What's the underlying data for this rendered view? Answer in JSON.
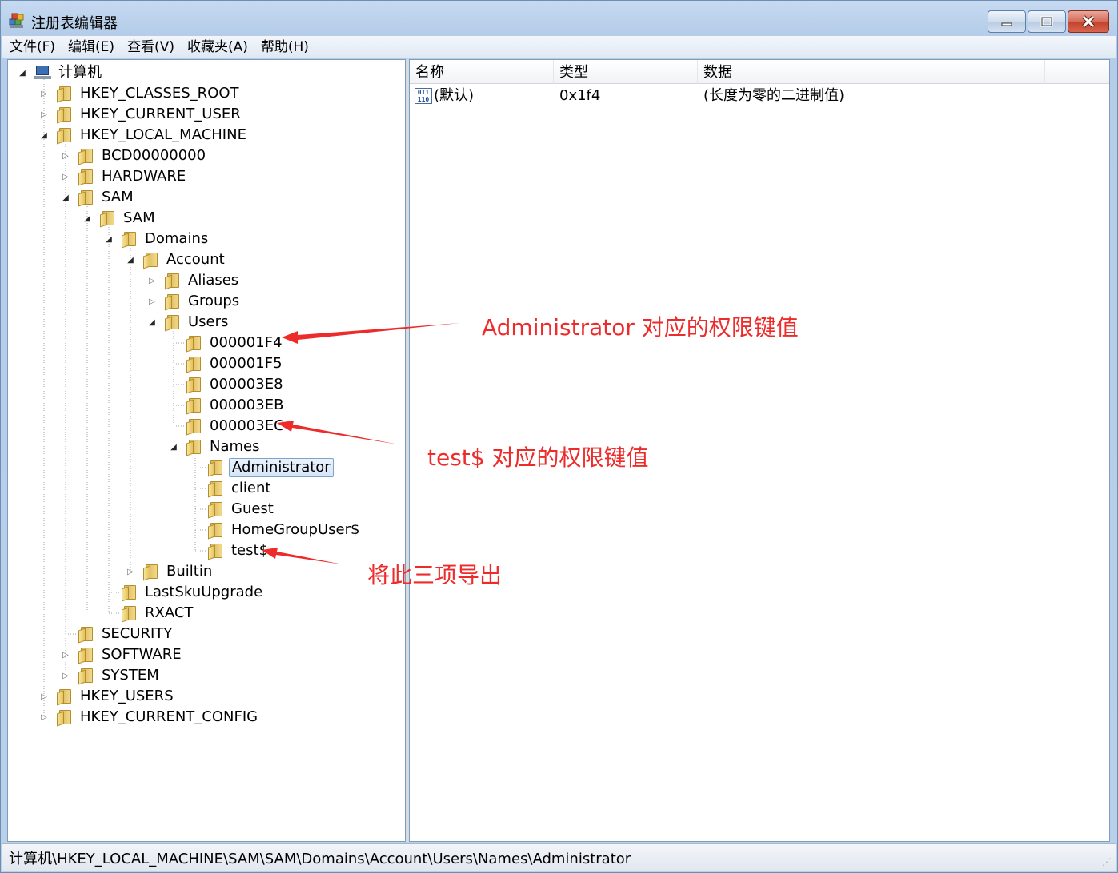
{
  "window": {
    "title": "注册表编辑器",
    "icon": "regedit-icon"
  },
  "menubar": {
    "items": [
      "文件(F)",
      "编辑(E)",
      "查看(V)",
      "收藏夹(A)",
      "帮助(H)"
    ]
  },
  "tree": {
    "root": "计算机",
    "nodes": [
      {
        "label": "HKEY_CLASSES_ROOT",
        "state": "collapsed"
      },
      {
        "label": "HKEY_CURRENT_USER",
        "state": "collapsed"
      },
      {
        "label": "HKEY_LOCAL_MACHINE",
        "state": "expanded"
      },
      {
        "label": "BCD00000000",
        "state": "collapsed"
      },
      {
        "label": "HARDWARE",
        "state": "collapsed"
      },
      {
        "label": "SAM",
        "state": "expanded"
      },
      {
        "label": "SAM",
        "state": "expanded"
      },
      {
        "label": "Domains",
        "state": "expanded"
      },
      {
        "label": "Account",
        "state": "expanded"
      },
      {
        "label": "Aliases",
        "state": "collapsed"
      },
      {
        "label": "Groups",
        "state": "collapsed"
      },
      {
        "label": "Users",
        "state": "expanded"
      },
      {
        "label": "000001F4",
        "state": "leaf"
      },
      {
        "label": "000001F5",
        "state": "leaf"
      },
      {
        "label": "000003E8",
        "state": "leaf"
      },
      {
        "label": "000003EB",
        "state": "leaf"
      },
      {
        "label": "000003EC",
        "state": "leaf"
      },
      {
        "label": "Names",
        "state": "expanded"
      },
      {
        "label": "Administrator",
        "state": "leaf",
        "selected": true
      },
      {
        "label": "client",
        "state": "leaf"
      },
      {
        "label": "Guest",
        "state": "leaf"
      },
      {
        "label": "HomeGroupUser$",
        "state": "leaf"
      },
      {
        "label": "test$",
        "state": "leaf"
      },
      {
        "label": "Builtin",
        "state": "collapsed"
      },
      {
        "label": "LastSkuUpgrade",
        "state": "leaf"
      },
      {
        "label": "RXACT",
        "state": "leaf"
      },
      {
        "label": "SECURITY",
        "state": "leaf"
      },
      {
        "label": "SOFTWARE",
        "state": "collapsed"
      },
      {
        "label": "SYSTEM",
        "state": "collapsed"
      },
      {
        "label": "HKEY_USERS",
        "state": "collapsed"
      },
      {
        "label": "HKEY_CURRENT_CONFIG",
        "state": "collapsed"
      }
    ]
  },
  "list": {
    "columns": [
      "名称",
      "类型",
      "数据"
    ],
    "rows": [
      {
        "name": "(默认)",
        "type": "0x1f4",
        "data": "(长度为零的二进制值)",
        "icon": "binary-value-icon"
      }
    ]
  },
  "status": {
    "path": "计算机\\HKEY_LOCAL_MACHINE\\SAM\\SAM\\Domains\\Account\\Users\\Names\\Administrator"
  },
  "annotations": {
    "color": "#ee2b2b",
    "items": [
      {
        "text": "Administrator 对应的权限键值"
      },
      {
        "text": "test$ 对应的权限键值"
      },
      {
        "text": "将此三项导出"
      }
    ]
  }
}
